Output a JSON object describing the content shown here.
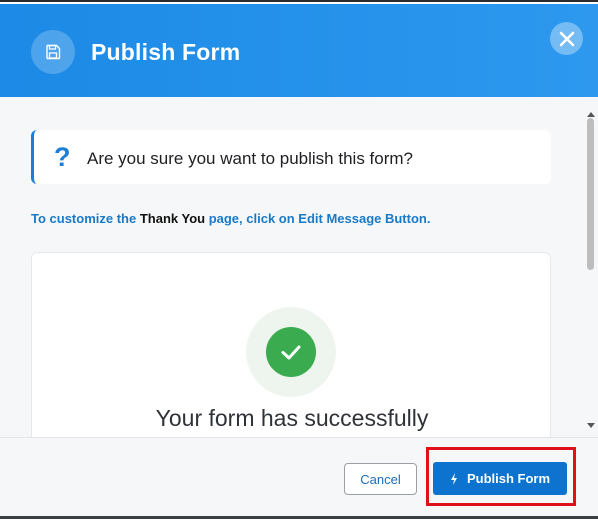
{
  "header": {
    "title": "Publish Form",
    "icon": "save-icon",
    "close_icon": "close-icon"
  },
  "question": {
    "mark": "?",
    "text": "Are you sure you want to publish this form?"
  },
  "hint": {
    "part1": "To customize the ",
    "part2": "Thank You",
    "part3": " page, click on Edit Message Button."
  },
  "preview": {
    "icon": "check-icon",
    "message": "Your form has successfully"
  },
  "footer": {
    "cancel_label": "Cancel",
    "publish_label": "Publish Form",
    "publish_icon": "bolt-icon"
  },
  "colors": {
    "header": "#1c8ae6",
    "primary": "#0e73cf",
    "success": "#3bab4f",
    "highlight": "#e0101a"
  }
}
